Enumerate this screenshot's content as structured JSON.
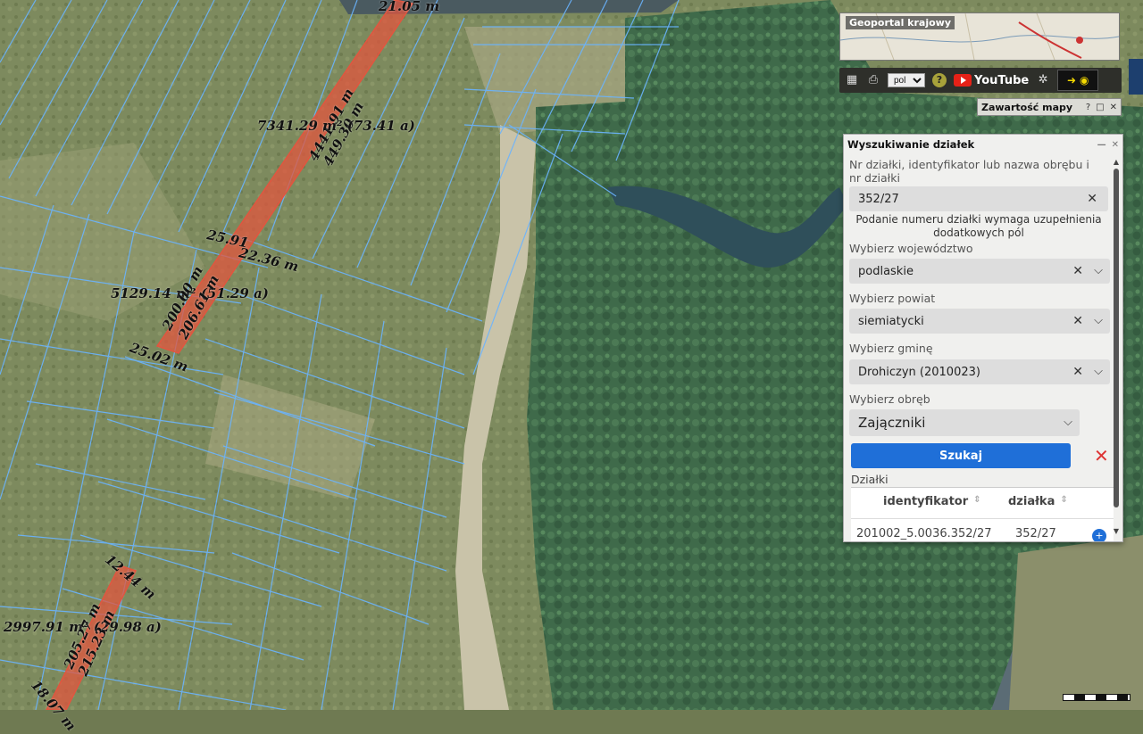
{
  "map": {
    "labels": {
      "dim_top": "21.05 m",
      "dim_4441": "4441.91 m",
      "dim_44930": "449.30 m",
      "area_top": "7341.29 m² (73.41 a)",
      "dim_2591": "25.91",
      "dim_2236": "22.36 m",
      "area_mid": "5129.14 m² (51.29 a)",
      "dim_20000": "200.00 m",
      "dim_2061": "206.61 m",
      "dim_2502": "25.02 m",
      "dim_1244": "12.44 m",
      "area_bottom": "2997.91 m² (29.98 a)",
      "dim_2052": "205.27 m",
      "dim_2155": "215.23 m",
      "dim_1807": "18.07 m"
    }
  },
  "minimap": {
    "title": "Geoportal krajowy"
  },
  "toolbar": {
    "lang_value": "pol",
    "youtube_label": "YouTube"
  },
  "content_bar": {
    "title": "Zawartość mapy",
    "help": "?"
  },
  "panel": {
    "title": "Wyszukiwanie działek",
    "query_label": "Nr działki, identyfikator lub nazwa obrębu i nr działki",
    "query_value": "352/27",
    "hint": "Podanie numeru działki wymaga uzupełnienia dodatkowych pól",
    "voivodeship_label": "Wybierz województwo",
    "voivodeship_value": "podlaskie",
    "county_label": "Wybierz powiat",
    "county_value": "siemiatycki",
    "commune_label": "Wybierz gminę",
    "commune_value": "Drohiczyn (2010023)",
    "precinct_label": "Wybierz obręb",
    "precinct_value": "Zajączniki",
    "search_label": "Szukaj",
    "results_label": "Działki",
    "columns": [
      "identyfikator",
      "działka"
    ],
    "rows": [
      {
        "id": "201002_5.0036.352/27",
        "parcel": "352/27"
      }
    ]
  },
  "colors": {
    "accent": "#1f6fd8",
    "parcel_highlight": "#e2553f",
    "parcel_lines": "#6ab4ff"
  }
}
